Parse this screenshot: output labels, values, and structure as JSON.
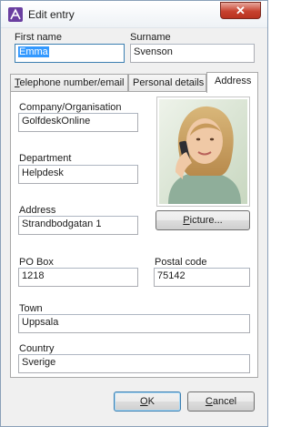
{
  "window": {
    "title": "Edit entry",
    "close_glyph": "✕"
  },
  "name": {
    "first_name_label": "First name",
    "first_name_value": "Emma",
    "surname_label": "Surname",
    "surname_value": "Svenson"
  },
  "tabs": [
    {
      "label": "Telephone number/email",
      "accel": "T",
      "rest": "elephone number/email"
    },
    {
      "label": "Personal details"
    },
    {
      "label": "Address",
      "active": true
    }
  ],
  "address": {
    "company_label": "Company/Organisation",
    "company_value": "GolfdeskOnline",
    "department_label": "Department",
    "department_value": "Helpdesk",
    "address_label": "Address",
    "address_value": "Strandbodgatan 1",
    "pobox_label": "PO Box",
    "pobox_value": "1218",
    "postal_label": "Postal code",
    "postal_value": "75142",
    "town_label": "Town",
    "town_value": "Uppsala",
    "country_label": "Country",
    "country_value": "Sverige"
  },
  "picture": {
    "button_accel": "P",
    "button_rest": "icture..."
  },
  "buttons": {
    "ok_accel": "O",
    "ok_rest": "K",
    "cancel_accel": "C",
    "cancel_rest": "ancel"
  },
  "icons": [
    "app-icon",
    "close-icon",
    "contact-photo"
  ]
}
